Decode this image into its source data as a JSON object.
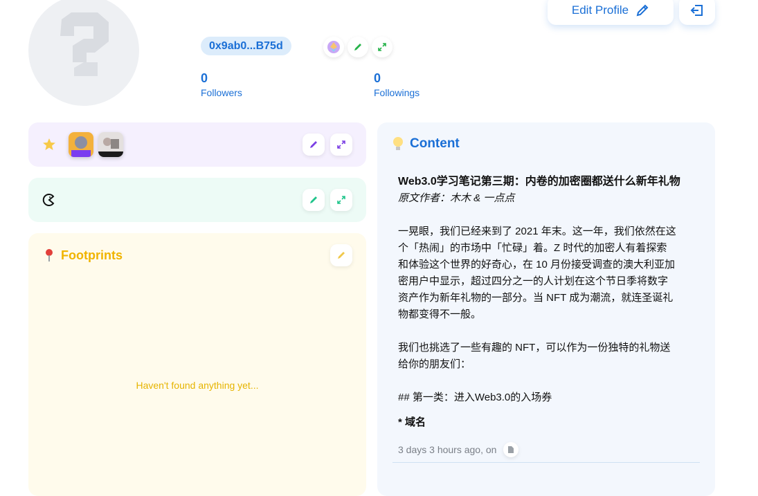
{
  "profile": {
    "address": "0x9ab0...B75d",
    "followers_count": "0",
    "followers_label": "Followers",
    "followings_count": "0",
    "followings_label": "Followings"
  },
  "header": {
    "edit_profile_label": "Edit Profile"
  },
  "footprints": {
    "title": "Footprints",
    "empty_text": "Haven't found anything yet..."
  },
  "content": {
    "title": "Content",
    "post": {
      "title": "Web3.0学习笔记第三期：内卷的加密圈都送什么新年礼物",
      "author": "原文作者：木木 & 一点点",
      "lines": [
        "一晃眼，我们已经来到了 2021 年末。这一年，我们依然在这",
        "个「热闹」的市场中「忙碌」着。Z 时代的加密人有着探索",
        "和体验这个世界的好奇心，在 10 月份接受调查的澳大利亚加",
        "密用户中显示，超过四分之一的人计划在这个节日季将数字",
        "资产作为新年礼物的一部分。当 NFT 成为潮流，就连圣诞礼",
        "物都变得不一般。"
      ],
      "lines2": [
        "我们也挑选了一些有趣的 NFT，可以作为一份独特的礼物送",
        "给你的朋友们："
      ],
      "heading": "## 第一类：进入Web3.0的入场券",
      "subheading": "* 域名",
      "meta": "3 days 3 hours ago, on"
    }
  },
  "colors": {
    "accent_blue": "#1a6fd6",
    "nft_bg": "#f5f0fe",
    "poap_bg": "#edfbf6",
    "footprint_bg": "#fffbec",
    "content_bg": "#f3f7fd",
    "footprint_accent": "#f0b400"
  },
  "icons": {
    "nft": "star-icon",
    "poap": "pacman-icon",
    "footprints": "pin-icon",
    "content": "bulb-icon"
  }
}
